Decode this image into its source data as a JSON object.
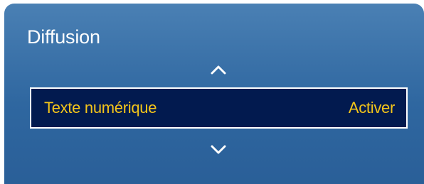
{
  "menu": {
    "title": "Diffusion",
    "up_icon": "chevron-up-icon",
    "down_icon": "chevron-down-icon",
    "selected_item": {
      "label": "Texte numérique",
      "value": "Activer"
    }
  },
  "colors": {
    "panel_top": "#4a80b4",
    "panel_bottom": "#2a5f98",
    "selected_background": "#021a4f",
    "selected_text": "#f3c51a",
    "border": "#ffffff"
  }
}
